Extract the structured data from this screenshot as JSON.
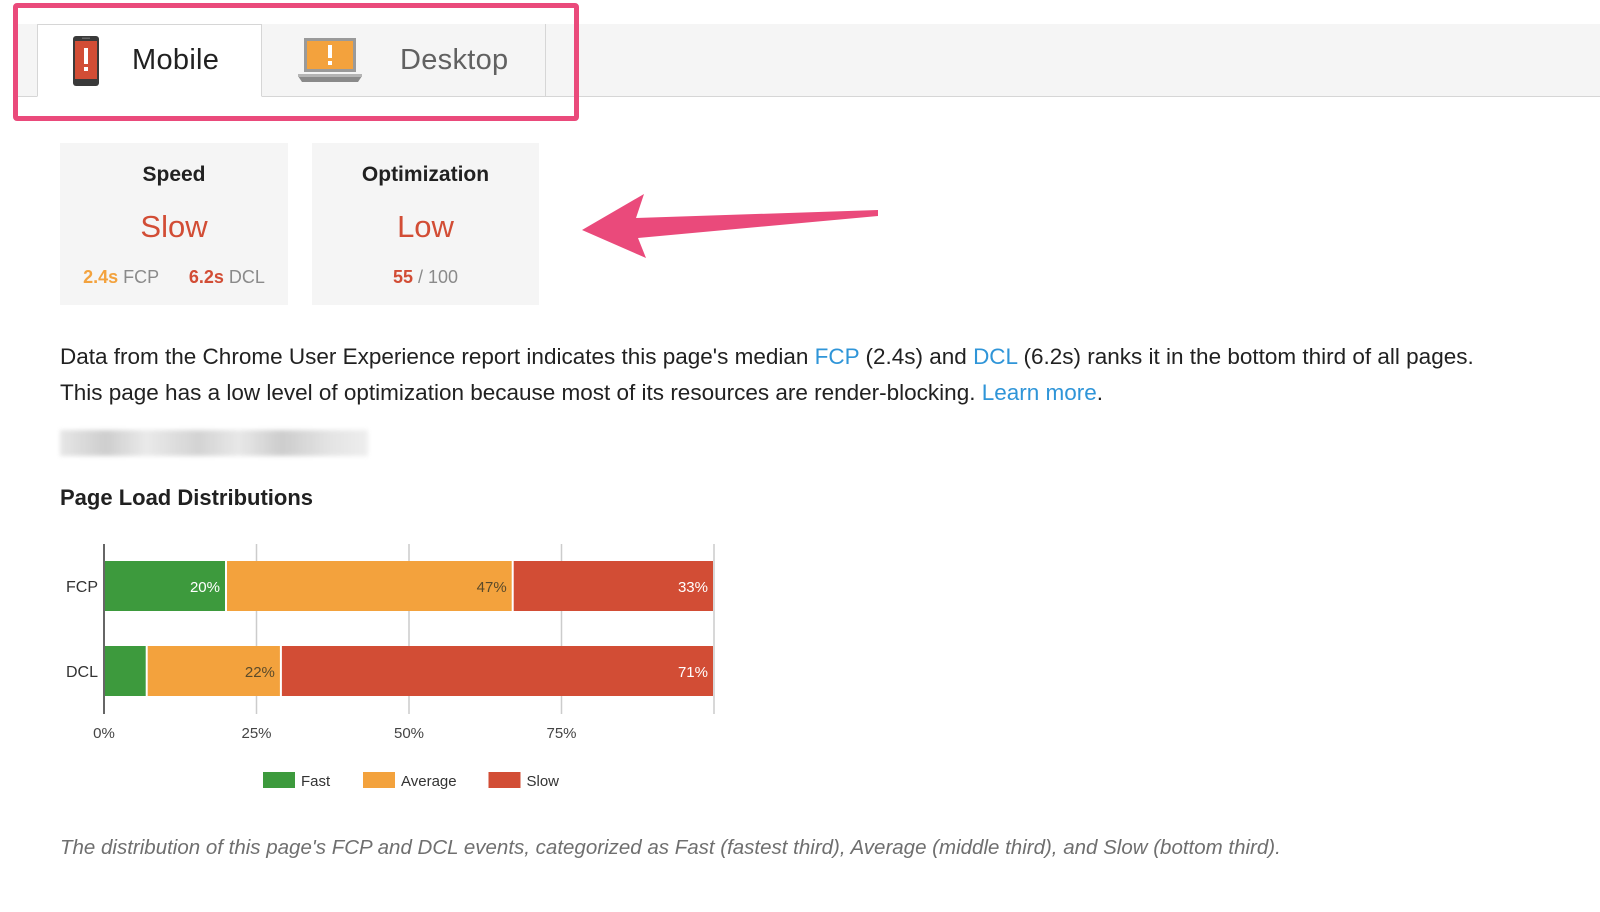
{
  "tabs": [
    {
      "label": "Mobile",
      "active": true,
      "icon": "phone-warning-icon"
    },
    {
      "label": "Desktop",
      "active": false,
      "icon": "laptop-warning-icon"
    }
  ],
  "colors": {
    "highlight": "#ea4a7b",
    "fast": "#3d9a3d",
    "average": "#f3a23d",
    "slow": "#d24d35",
    "link": "#2f95d8"
  },
  "speed_card": {
    "title": "Speed",
    "value": "Slow",
    "fcp_value": "2.4s",
    "fcp_label": "FCP",
    "dcl_value": "6.2s",
    "dcl_label": "DCL"
  },
  "optimization_card": {
    "title": "Optimization",
    "value": "Low",
    "score": "55",
    "score_suffix": "/ 100"
  },
  "description": {
    "line1_a": "Data from the Chrome User Experience report indicates this page's median ",
    "fcp_link": "FCP",
    "line1_b": " (2.4s) and ",
    "dcl_link": "DCL",
    "line1_c": " (6.2s) ranks it in the bottom third of all pages.",
    "line2_a": "This page has a low level of optimization because most of its resources are render-blocking. ",
    "learn_more": "Learn more",
    "line2_b": "."
  },
  "section_title": "Page Load Distributions",
  "chart_data": {
    "type": "bar",
    "orientation": "horizontal",
    "stacked": true,
    "categories": [
      "FCP",
      "DCL"
    ],
    "series": [
      {
        "name": "Fast",
        "values": [
          20,
          7
        ],
        "labels": [
          "20%",
          ""
        ]
      },
      {
        "name": "Average",
        "values": [
          47,
          22
        ],
        "labels": [
          "47%",
          "22%"
        ]
      },
      {
        "name": "Slow",
        "values": [
          33,
          71
        ],
        "labels": [
          "33%",
          "71%"
        ]
      }
    ],
    "xlim": [
      0,
      100
    ],
    "xticks": [
      {
        "value": 0,
        "label": "0%"
      },
      {
        "value": 25,
        "label": "25%"
      },
      {
        "value": 50,
        "label": "50%"
      },
      {
        "value": 75,
        "label": "75%"
      },
      {
        "value": 100,
        "label": ""
      }
    ],
    "grid": true,
    "legend": "bottom"
  },
  "caption": "The distribution of this page's FCP and DCL events, categorized as Fast (fastest third), Average (middle third), and Slow (bottom third)."
}
